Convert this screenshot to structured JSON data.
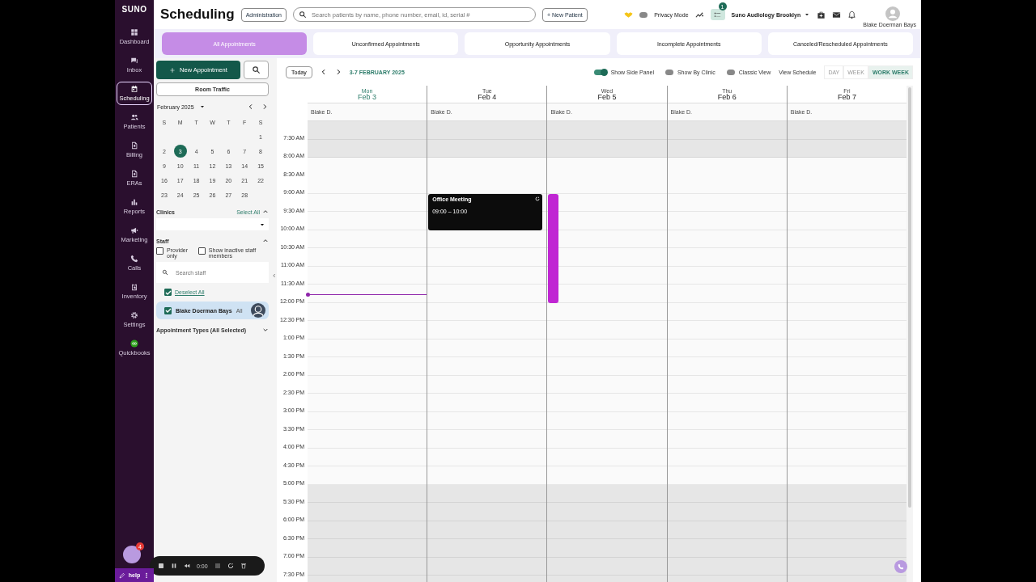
{
  "sidebar": {
    "logo": "SUNO",
    "items": [
      {
        "label": "Dashboard",
        "selected": false
      },
      {
        "label": "Inbox",
        "selected": false
      },
      {
        "label": "Scheduling",
        "selected": true
      },
      {
        "label": "Patients",
        "selected": false
      },
      {
        "label": "Billing",
        "selected": false
      },
      {
        "label": "ERAs",
        "selected": false
      },
      {
        "label": "Reports",
        "selected": false
      },
      {
        "label": "Marketing",
        "selected": false
      },
      {
        "label": "Calls",
        "selected": false
      },
      {
        "label": "Inventory",
        "selected": false
      },
      {
        "label": "Settings",
        "selected": false
      },
      {
        "label": "Quickbooks",
        "selected": false
      }
    ]
  },
  "header": {
    "title": "Scheduling",
    "admin_button": "Administration",
    "search": {
      "placeholder": "Search patients by name, phone number, email, id, serial #"
    },
    "new_patient_button": "+ New Patient",
    "privacy_mode": {
      "label": "Privacy Mode",
      "on": false
    },
    "tasks_badge": "1",
    "clinic": "Suno Audiology Brooklyn",
    "user": "Blake Doerman Bays"
  },
  "tabs": [
    {
      "label": "All Appointments",
      "selected": true
    },
    {
      "label": "Unconfirmed Appointments",
      "selected": false
    },
    {
      "label": "Opportunity Appointments",
      "selected": false
    },
    {
      "label": "Incomplete Appointments",
      "selected": false
    },
    {
      "label": "Canceled/Rescheduled Appointments",
      "selected": false
    }
  ],
  "side_panel": {
    "new_appointment": "New Appointment",
    "room_traffic": "Room Traffic",
    "mini_calendar": {
      "month": "February 2025",
      "weekdays": [
        "S",
        "M",
        "T",
        "W",
        "T",
        "F",
        "S"
      ],
      "weeks": [
        [
          {
            "day": "1",
            "selected": false
          }
        ],
        [
          {
            "day": "2",
            "selected": false
          },
          {
            "day": "3",
            "selected": true
          },
          {
            "day": "4",
            "selected": false
          },
          {
            "day": "5",
            "selected": false
          },
          {
            "day": "6",
            "selected": false
          },
          {
            "day": "7",
            "selected": false
          },
          {
            "day": "8",
            "selected": false
          }
        ],
        [
          {
            "day": "9",
            "selected": false
          },
          {
            "day": "10",
            "selected": false
          },
          {
            "day": "11",
            "selected": false
          },
          {
            "day": "12",
            "selected": false
          },
          {
            "day": "13",
            "selected": false
          },
          {
            "day": "14",
            "selected": false
          },
          {
            "day": "15",
            "selected": false
          }
        ],
        [
          {
            "day": "16",
            "selected": false
          },
          {
            "day": "17",
            "selected": false
          },
          {
            "day": "18",
            "selected": false
          },
          {
            "day": "19",
            "selected": false
          },
          {
            "day": "20",
            "selected": false
          },
          {
            "day": "21",
            "selected": false
          },
          {
            "day": "22",
            "selected": false
          }
        ],
        [
          {
            "day": "23",
            "selected": false
          },
          {
            "day": "24",
            "selected": false
          },
          {
            "day": "25",
            "selected": false
          },
          {
            "day": "26",
            "selected": false
          },
          {
            "day": "27",
            "selected": false
          },
          {
            "day": "28",
            "selected": false
          }
        ]
      ]
    },
    "clinics": {
      "label": "Clinics",
      "select_all": "Select All"
    },
    "staff": {
      "label": "Staff",
      "options": [
        {
          "label": "Provider only",
          "checked": false
        },
        {
          "label": "Show inactive staff members",
          "checked": false
        }
      ],
      "search": {
        "placeholder": "Search staff"
      },
      "deselect_all": {
        "label": "Deselect All",
        "checked": true
      },
      "members": [
        {
          "name": "Blake Doerman Bays",
          "tag": "All",
          "checked": true
        }
      ]
    },
    "appointment_types": "Appointment Types (All Selected)"
  },
  "calendar": {
    "today_button": "Today",
    "range": "3-7 FEBRUARY 2025",
    "toggles": [
      {
        "label": "Show Side Panel",
        "on": true
      },
      {
        "label": "Show By Clinic",
        "on": false
      },
      {
        "label": "Classic View",
        "on": false
      }
    ],
    "view_schedule": "View Schedule",
    "views": [
      {
        "label": "DAY",
        "selected": false
      },
      {
        "label": "WEEK",
        "selected": false
      },
      {
        "label": "WORK WEEK",
        "selected": true
      }
    ],
    "days": [
      {
        "weekday": "Mon",
        "date": "Feb 3",
        "today": true,
        "staff": "Blake D."
      },
      {
        "weekday": "Tue",
        "date": "Feb 4",
        "today": false,
        "staff": "Blake D.",
        "events": [
          {
            "kind": "meeting",
            "title": "Office Meeting",
            "time": "09:00 – 10:00"
          }
        ]
      },
      {
        "weekday": "Wed",
        "date": "Feb 5",
        "today": false,
        "staff": "Blake D.",
        "events": [
          {
            "kind": "block",
            "color": "#c026d3"
          }
        ]
      },
      {
        "weekday": "Thu",
        "date": "Feb 6",
        "today": false,
        "staff": "Blake D."
      },
      {
        "weekday": "Fri",
        "date": "Feb 7",
        "today": false,
        "staff": "Blake D."
      }
    ],
    "times": [
      "7:30 AM",
      "8:00 AM",
      "8:30 AM",
      "9:00 AM",
      "9:30 AM",
      "10:00 AM",
      "10:30 AM",
      "11:00 AM",
      "11:30 AM",
      "12:00 PM",
      "12:30 PM",
      "1:00 PM",
      "1:30 PM",
      "2:00 PM",
      "2:30 PM",
      "3:00 PM",
      "3:30 PM",
      "4:00 PM",
      "4:30 PM",
      "5:00 PM",
      "5:30 PM",
      "6:00 PM",
      "6:30 PM",
      "7:00 PM",
      "7:30 PM"
    ]
  },
  "overlays": {
    "chat_badge": "4",
    "recorder_time": "0:00",
    "help": "help"
  }
}
